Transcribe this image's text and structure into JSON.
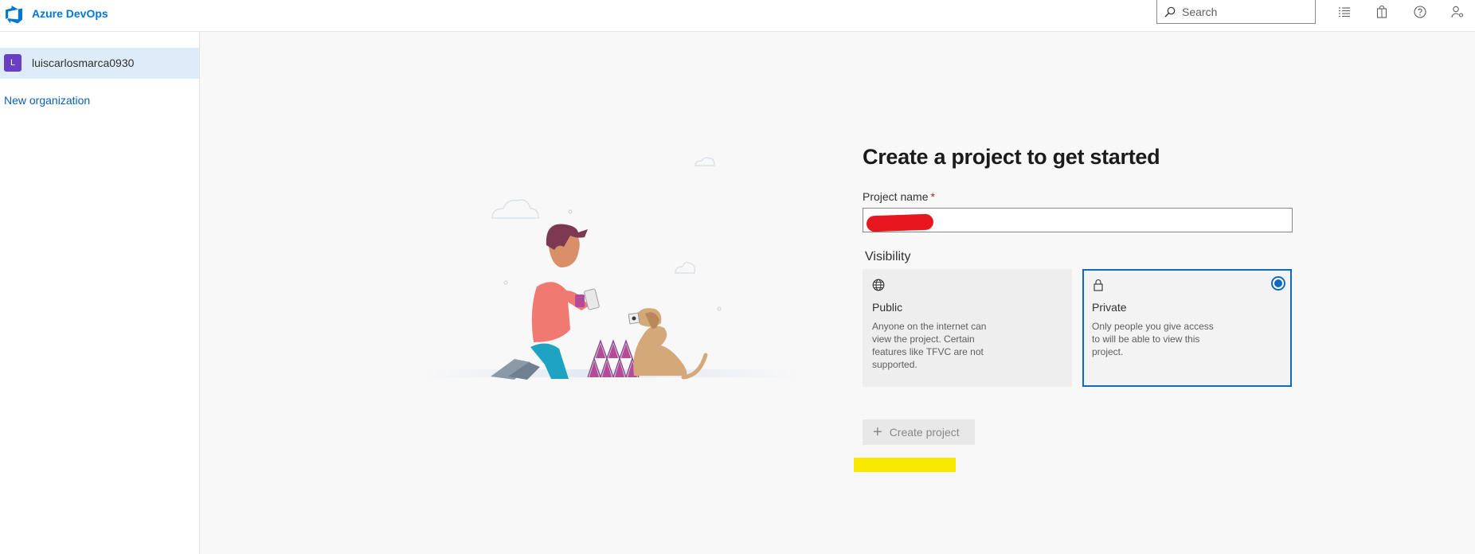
{
  "header": {
    "brand": "Azure DevOps",
    "search": {
      "placeholder": "Search",
      "value": ""
    },
    "icons": [
      "list-icon",
      "shopping-bag-icon",
      "help-icon",
      "user-settings-icon"
    ]
  },
  "sidebar": {
    "organizations": [
      {
        "initial": "L",
        "name": "luiscarlosmarca0930",
        "selected": true
      }
    ],
    "new_org_label": "New organization"
  },
  "form": {
    "title": "Create a project to get started",
    "project_name_label": "Project name",
    "required_marker": "*",
    "project_name_value": "",
    "visibility_label": "Visibility",
    "options": [
      {
        "icon": "globe-icon",
        "title": "Public",
        "description": "Anyone on the internet can view the project. Certain features like TFVC are not supported.",
        "selected": false
      },
      {
        "icon": "lock-icon",
        "title": "Private",
        "description": "Only people you give access to will be able to view this project.",
        "selected": true
      }
    ],
    "create_button_label": "Create project",
    "create_button_enabled": false
  },
  "colors": {
    "accent": "#0078d4",
    "selected_border": "#0f6cbd",
    "sidebar_selected": "#deecf9",
    "avatar": "#6b3fc4",
    "redaction": "#e8161e",
    "highlight": "#f8e800"
  }
}
